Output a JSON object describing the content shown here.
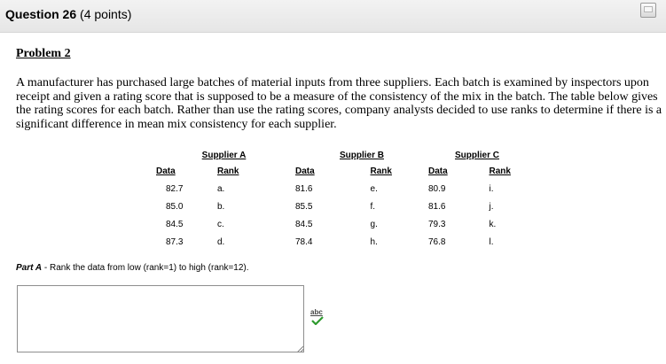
{
  "question": {
    "title": "Question 26",
    "points": "(4 points)"
  },
  "problem": {
    "heading": "Problem 2",
    "text": "A manufacturer has purchased large batches of material inputs from three suppliers. Each batch is examined by inspectors upon receipt and given a rating score that is supposed to be a measure of the consistency of the mix in the batch. The table below gives the rating scores for each batch. Rather than use the rating scores, company analysts decided to use ranks to determine if there is a significant difference in mean mix consistency for each supplier."
  },
  "table": {
    "suppliers": [
      "Supplier A",
      "Supplier B",
      "Supplier C"
    ],
    "data_header": "Data",
    "rank_header": "Rank",
    "rows": [
      [
        "82.7",
        "a.",
        "81.6",
        "e.",
        "80.9",
        "i."
      ],
      [
        "85.0",
        "b.",
        "85.5",
        "f.",
        "81.6",
        "j."
      ],
      [
        "84.5",
        "c.",
        "84.5",
        "g.",
        "79.3",
        "k."
      ],
      [
        "87.3",
        "d.",
        "78.4",
        "h.",
        "76.8",
        "l."
      ]
    ]
  },
  "part_a": {
    "label": "Part A",
    "text": " - Rank the data from low (rank=1) to high (rank=12).",
    "answer_value": ""
  },
  "icons": {
    "save": "save-icon",
    "spellcheck": "spellcheck-icon",
    "spellcheck_text": "abc"
  }
}
